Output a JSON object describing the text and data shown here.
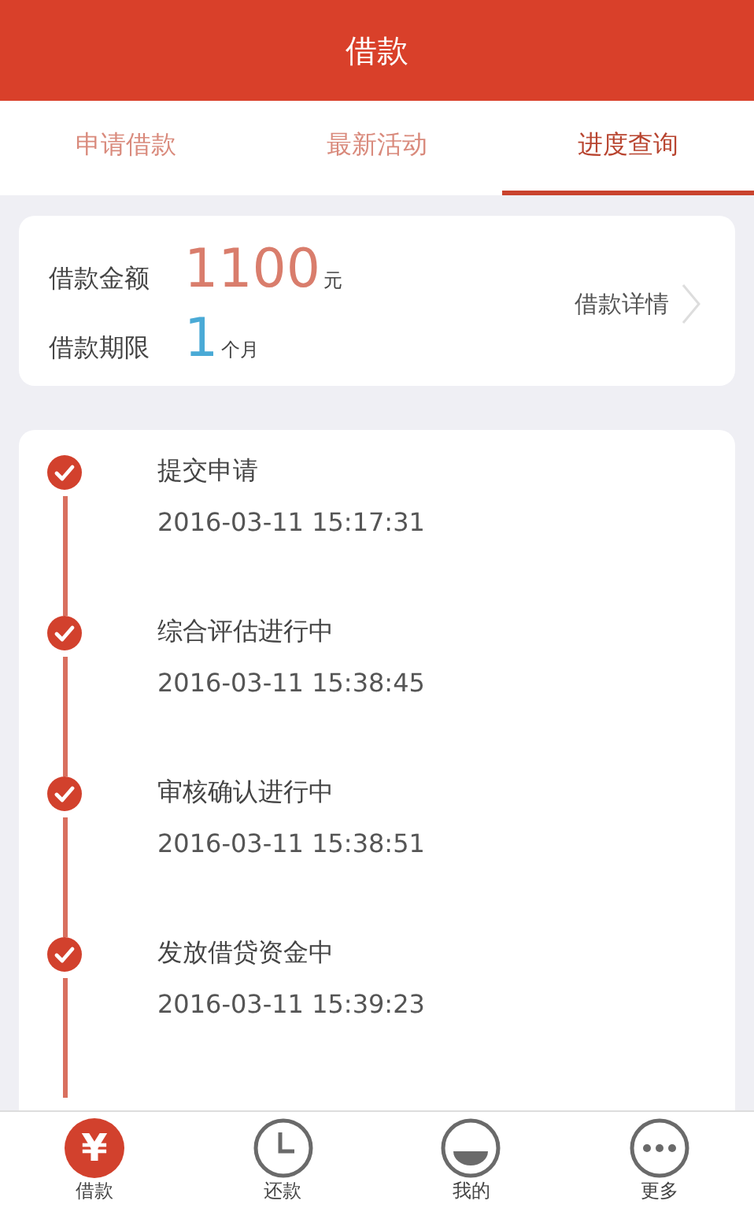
{
  "header": {
    "title": "借款"
  },
  "tabs": [
    {
      "label": "申请借款",
      "selected": false
    },
    {
      "label": "最新活动",
      "selected": false
    },
    {
      "label": "进度查询",
      "selected": true
    }
  ],
  "loan": {
    "amount_label": "借款金额",
    "amount": "1100",
    "amount_unit": "元",
    "term_label": "借款期限",
    "term": "1",
    "term_unit": "个月",
    "details_link": "借款详情"
  },
  "steps": [
    {
      "title": "提交申请",
      "time": "2016-03-11 15:17:31",
      "done": true
    },
    {
      "title": "综合评估进行中",
      "time": "2016-03-11 15:38:45",
      "done": true
    },
    {
      "title": "审核确认进行中",
      "time": "2016-03-11 15:38:51",
      "done": true
    },
    {
      "title": "发放借贷资金中",
      "time": "2016-03-11 15:39:23",
      "done": true
    }
  ],
  "bottom_nav": [
    {
      "label": "借款",
      "kind": "yen",
      "glyph": "¥",
      "selected": true
    },
    {
      "label": "还款",
      "kind": "clock",
      "selected": false
    },
    {
      "label": "我的",
      "kind": "face",
      "selected": false
    },
    {
      "label": "更多",
      "kind": "more",
      "selected": false
    }
  ]
}
